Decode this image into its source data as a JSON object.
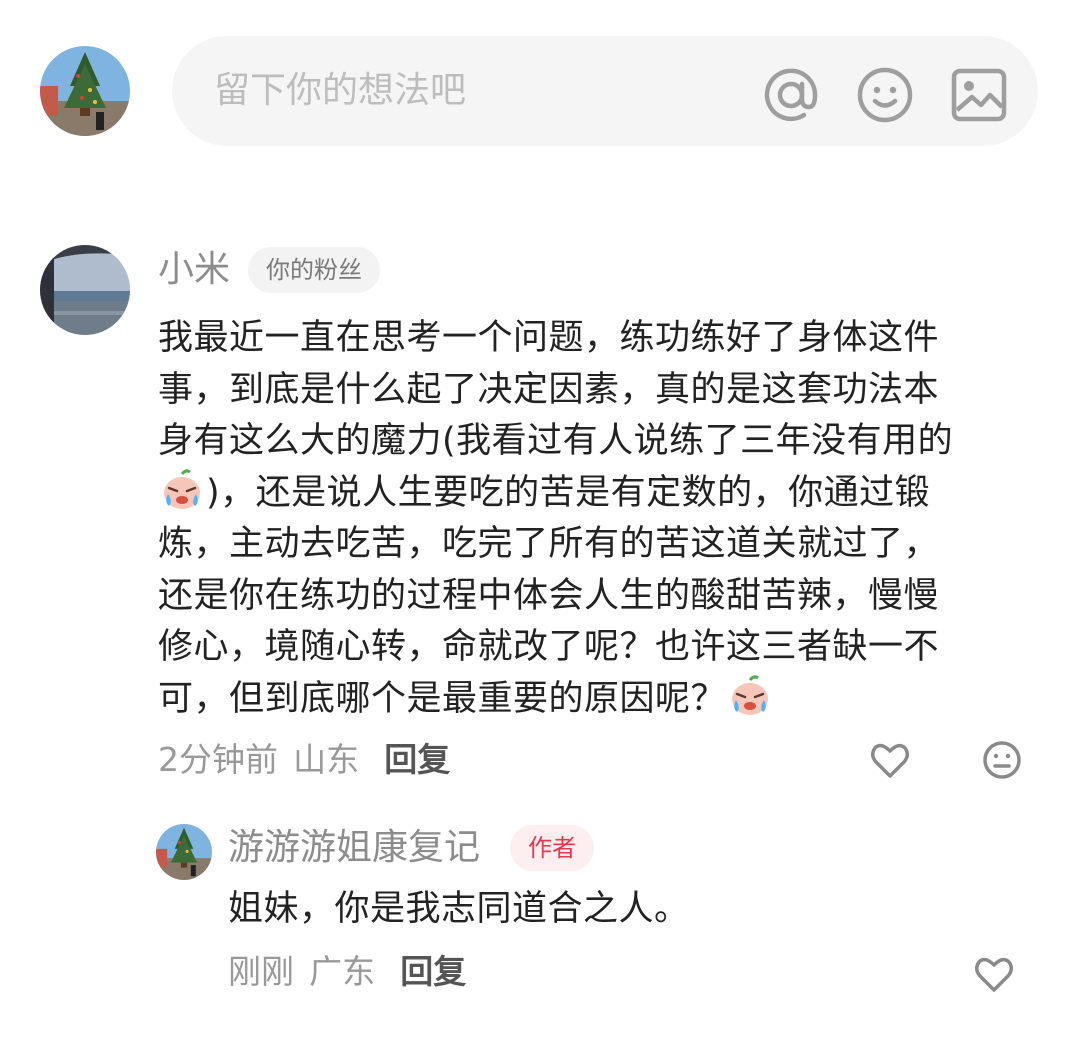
{
  "composer": {
    "placeholder": "留下你的想法吧",
    "icons": [
      "at-icon",
      "emoji-icon",
      "image-icon"
    ]
  },
  "comment": {
    "username": "小米",
    "badge": "你的粉丝",
    "lines": [
      "我最近一直在思考一个问题，练功练好了身体这件",
      "事，到底是什么起了决定因素，真的是这套功法本",
      "身有这么大的魔力(我看过有人说练了三年没有用的"
    ],
    "line4_text": ")，还是说人生要吃的苦是有定数的，你通过锻",
    "lines_b": [
      "炼，主动去吃苦，吃完了所有的苦这道关就过了，",
      "还是你在练功的过程中体会人生的酸甜苦辣，慢慢",
      "修心，境随心转，命就改了呢？也许这三者缺一不"
    ],
    "line8_text": "可，但到底哪个是最重要的原因呢？",
    "emoji": "crying-peach-emoji",
    "time": "2分钟前",
    "location": "山东",
    "reply_label": "回复"
  },
  "reply": {
    "username": "游游游姐康复记",
    "badge": "作者",
    "text": "姐妹，你是我志同道合之人。",
    "time": "刚刚",
    "location": "广东",
    "reply_label": "回复"
  },
  "colors": {
    "author_badge_text": "#e8384d",
    "author_badge_bg": "#fdeef0",
    "composer_bg": "#f5f5f5",
    "icon_gray": "#9e9e9e"
  }
}
